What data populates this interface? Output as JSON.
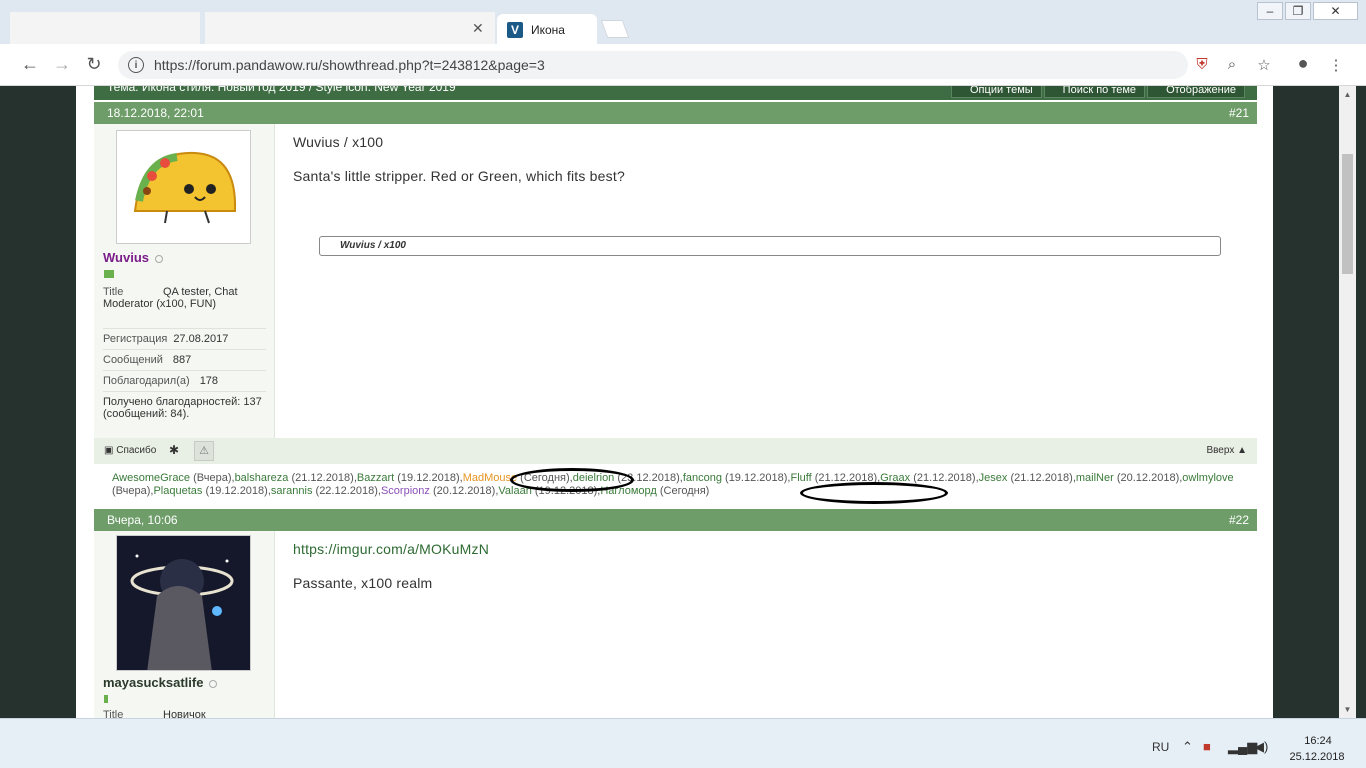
{
  "browser": {
    "tab_title": "Икона",
    "tab_icon": "V",
    "url": "https://forum.pandawow.ru/showthread.php?t=243812&page=3",
    "window_controls": [
      "–",
      "❐",
      "✕"
    ]
  },
  "thread": {
    "title": "Тема: Икона стиля. Новый год 2019 / Style icon. New Year 2019",
    "tools": [
      "Опции темы",
      "Поиск по теме",
      "Отображение"
    ]
  },
  "post1": {
    "date": "18.12.2018, 22:01",
    "number": "#21",
    "user": {
      "name": "Wuvius",
      "name_color": "#7b1d8a",
      "title_label": "Title",
      "title_value": "QA tester, Chat Moderator (x100, FUN)",
      "reg_label": "Регистрация",
      "reg_value": "27.08.2017",
      "msgs_label": "Сообщений",
      "msgs_value": "887",
      "thanked_label": "Поблагодарил(а)",
      "thanked_value": "178",
      "received": "Получено благодарностей: 137 (сообщений: 84)."
    },
    "heading": "Wuvius / x100",
    "text": "Santa's little stripper. Red or Green, which fits best?",
    "quote": "Wuvius / x100"
  },
  "thanks_bar": {
    "thanks_label": "Спасибо",
    "top_label": "Вверх ▲"
  },
  "thanks_list": [
    {
      "name": "AwesomeGrace",
      "when": " (Вчера),",
      "cls": "n"
    },
    {
      "name": "balshareza",
      "when": " (21.12.2018),",
      "cls": "n"
    },
    {
      "name": "Bazzart",
      "when": " (19.12.2018),",
      "cls": "n"
    },
    {
      "name": "MadMouse",
      "when": " (Сегодня),",
      "cls": "o"
    },
    {
      "name": "deielrion",
      "when": " (23.12.2018),",
      "cls": "n"
    },
    {
      "name": "fancong",
      "when": " (19.12.2018),",
      "cls": "n"
    },
    {
      "name": "Fluff",
      "when": " (21.12.2018),",
      "cls": "n"
    },
    {
      "name": "Graax",
      "when": " (21.12.2018),",
      "cls": "n"
    },
    {
      "name": "Jesex",
      "when": " (21.12.2018),",
      "cls": "n"
    },
    {
      "name": "mailNer",
      "when": " (20.12.2018),",
      "cls": "n"
    },
    {
      "name": "owlmylove",
      "when": " (Вчера),",
      "cls": "n"
    },
    {
      "name": "Plaquetas",
      "when": " (19.12.2018),",
      "cls": "n"
    },
    {
      "name": "sarannis",
      "when": " (22.12.2018),",
      "cls": "n"
    },
    {
      "name": "Scorpionz",
      "when": " (20.12.2018),",
      "cls": "p"
    },
    {
      "name": "Valaah",
      "when": " (19.12.2018),",
      "cls": "n"
    },
    {
      "name": "Нагломорд",
      "when": " (Сегодня)",
      "cls": "n"
    }
  ],
  "post2": {
    "date": "Вчера, 10:06",
    "number": "#22",
    "user": {
      "name": "mayasucksatlife",
      "name_color": "#2b3a2b",
      "title_label": "Title",
      "title_value": "Новичок"
    },
    "link": "https://imgur.com/a/MOKuMzN",
    "text": "Passante, x100 realm"
  },
  "taskbar": {
    "lang": "RU",
    "time": "16:24",
    "date": "25.12.2018"
  }
}
